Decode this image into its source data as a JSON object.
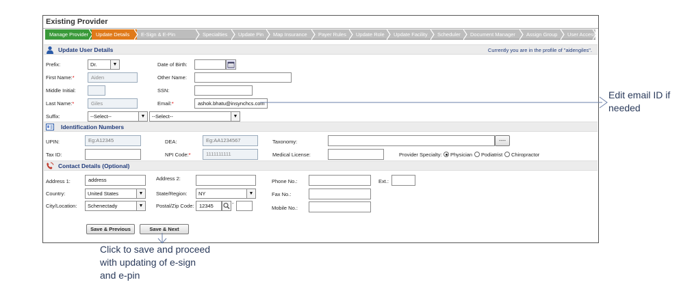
{
  "window": {
    "title": "Existing Provider"
  },
  "tabs": [
    {
      "label": "Manage Provider",
      "state": "done"
    },
    {
      "label": "Update Details",
      "state": "active"
    },
    {
      "label": "E-Sign & E-Pin",
      "state": "todo"
    },
    {
      "label": "Specialties",
      "state": "todo"
    },
    {
      "label": "Update Pin",
      "state": "todo"
    },
    {
      "label": "Map Insurance",
      "state": "todo"
    },
    {
      "label": "Payer Rules",
      "state": "todo"
    },
    {
      "label": "Update Role",
      "state": "todo"
    },
    {
      "label": "Update Facility",
      "state": "todo"
    },
    {
      "label": "Scheduler",
      "state": "todo"
    },
    {
      "label": "Document Manager",
      "state": "todo"
    },
    {
      "label": "Assign Group",
      "state": "todo"
    },
    {
      "label": "User Access",
      "state": "todo"
    }
  ],
  "colors": {
    "tab_done": "#3a9a3a",
    "tab_active": "#e07a1a",
    "tab_todo": "#bdbdbd",
    "section_title": "#1f3a7a",
    "required": "#dd0000"
  },
  "user_details": {
    "heading": "Update User Details",
    "profile_note": "Currently you are in the profile of \"aidengiles\".",
    "prefix_label": "Prefix:",
    "prefix_value": "Dr.",
    "dob_label": "Date of Birth:",
    "dob_value": "",
    "first_name_label": "First Name:",
    "first_name_value": "Aiden",
    "other_name_label": "Other Name:",
    "other_name_value": "",
    "middle_initial_label": "Middle Initial:",
    "middle_initial_value": "",
    "ssn_label": "SSN:",
    "ssn_value": "",
    "last_name_label": "Last Name:",
    "last_name_value": "Giles",
    "email_label": "Email:",
    "email_value": "ashok.bhatu@insynchcs.com",
    "suffix_label": "Suffix:",
    "suffix_value": "--Select--",
    "suffix2_value": "--Select--",
    "required_mark": "*"
  },
  "identification": {
    "heading": "Identification Numbers",
    "upin_label": "UPIN:",
    "upin_placeholder": "Eg:A12345",
    "dea_label": "DEA:",
    "dea_placeholder": "Eg:AA1234567",
    "taxonomy_label": "Taxonomy:",
    "taxonomy_value": "",
    "taxonomy_button": "----",
    "tax_id_label": "Tax ID:",
    "tax_id_value": "",
    "npi_label": "NPI Code:",
    "npi_value": "1111111111",
    "medical_license_label": "Medical License:",
    "medical_license_value": "",
    "specialty_label": "Provider Specialty:",
    "specialty_options": [
      "Physician",
      "Podiatrist",
      "Chiropractor"
    ],
    "specialty_selected": "Physician"
  },
  "contact": {
    "heading": "Contact Details (Optional)",
    "address1_label": "Address 1:",
    "address1_value": "address",
    "address2_label": "Address 2:",
    "address2_value": "",
    "phone_label": "Phone No.:",
    "phone_value": "",
    "ext_label": "Ext.:",
    "ext_value": "",
    "country_label": "Country:",
    "country_value": "United States",
    "state_label": "State/Region:",
    "state_value": "NY",
    "fax_label": "Fax No.:",
    "fax_value": "",
    "city_label": "City/Location:",
    "city_value": "Schenectady",
    "zip_label": "Postal/Zip Code:",
    "zip_value": "12345",
    "zip_dash": "-",
    "zip_ext_value": "",
    "mobile_label": "Mobile No.:",
    "mobile_value": ""
  },
  "actions": {
    "save_previous": "Save & Previous",
    "save_next": "Save & Next"
  },
  "callouts": {
    "email": [
      "Edit email ID if",
      "needed"
    ],
    "save_next": [
      "Click to save and proceed",
      "with updating of e-sign",
      "and e-pin"
    ]
  }
}
